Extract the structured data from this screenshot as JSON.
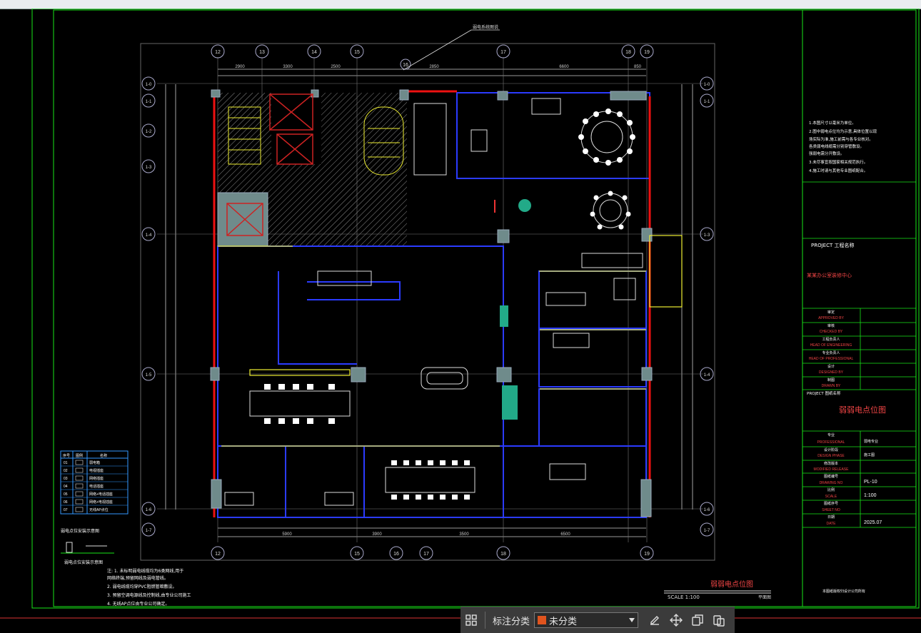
{
  "drawing": {
    "grid_top": [
      "12",
      "13",
      "14",
      "15",
      "16",
      "17",
      "18",
      "19"
    ],
    "grid_bottom": [
      "12",
      "15",
      "16",
      "17",
      "18",
      "19"
    ],
    "grid_left": [
      "1-0",
      "1-1",
      "1-2",
      "1-3",
      "1-4",
      "1-5",
      "1-6",
      "1-7"
    ],
    "grid_right": [
      "1-0",
      "1-1",
      "1-3",
      "1-4",
      "1-6",
      "1-7"
    ],
    "dims_top": [
      "2900",
      "3300",
      "2500",
      "6600",
      "2850",
      "850"
    ],
    "dims_bottom": [
      "5900",
      "3900",
      "3500",
      "6500"
    ],
    "callout": "弱电系统图说",
    "sheet_title": "弱弱电点位图",
    "scale_label": "SCALE 1:100",
    "plan_label": "平面图",
    "notes": [
      "注: 1. 未标明弱电线缆均为6类网线,用于",
      "   网络终端,预留网线及弱电管线。",
      "   2. 弱电线缆均穿PVC阻燃管暗敷设。",
      "   3. 预留空调电源线及控制线,由专业公司施工",
      "   4. 无线AP点位由专业公司确定。"
    ],
    "detail_title": "弱电点位安装示意图",
    "detail_caption": "弱电点位安装示意图"
  },
  "legend": {
    "headers": [
      "序号",
      "图例",
      "名称"
    ],
    "rows": [
      {
        "no": "01",
        "name": "弱电箱"
      },
      {
        "no": "02",
        "name": "电视插座"
      },
      {
        "no": "03",
        "name": "网络插座"
      },
      {
        "no": "04",
        "name": "电话插座"
      },
      {
        "no": "05",
        "name": "网络+电话插座"
      },
      {
        "no": "06",
        "name": "网络+电视插座"
      },
      {
        "no": "07",
        "name": "无线AP点位"
      }
    ]
  },
  "title_block": {
    "notes": [
      "1.本图尺寸以毫米为单位。",
      "2.图中弱电点位均为示意,具体位置以现",
      "  场实际为准,施工前需与各专业核对。",
      "  各类弱电线缆需分别穿管敷设。",
      "  强弱电需分开敷设。",
      "3.未尽事宜按国家相关规范执行。",
      "4.施工时请与其他专业图纸配合。"
    ],
    "project_label": "PROJECT 工程名称",
    "project_name": "某某办公室装修中心",
    "rows": [
      {
        "cn": "审定",
        "en": "APPROVED BY"
      },
      {
        "cn": "审核",
        "en": "CHECKED BY"
      },
      {
        "cn": "工程负责人",
        "en": "HEAD OF ENGINEERING"
      },
      {
        "cn": "专业负责人",
        "en": "HEAD OF PROFESSIONAL"
      },
      {
        "cn": "设计",
        "en": "DESIGNED BY"
      },
      {
        "cn": "制图",
        "en": "DRAWN BY"
      }
    ],
    "drawing_label": "PROJECT 图纸名称",
    "drawing_title": "弱弱电点位图",
    "info": [
      {
        "cn": "专业",
        "en": "PROFESSIONAL",
        "val": "弱电专业"
      },
      {
        "cn": "设计阶段",
        "en": "DESIGN PHASE",
        "val": "施工图"
      },
      {
        "cn": "修改版本",
        "en": "MODIFIED RELEASE",
        "val": ""
      },
      {
        "cn": "图纸编号",
        "en": "DRAWING NO",
        "val": "PL-10"
      },
      {
        "cn": "比例",
        "en": "SCALE",
        "val": "1:100"
      },
      {
        "cn": "图纸序号",
        "en": "SHEET NO",
        "val": ""
      },
      {
        "cn": "日期",
        "en": "DATE",
        "val": "2025.07"
      }
    ],
    "footer": "本图纸版权归设计公司所有"
  },
  "toolbar": {
    "label": "标注分类",
    "select_value": "未分类",
    "swatch_color": "#e0541e"
  }
}
